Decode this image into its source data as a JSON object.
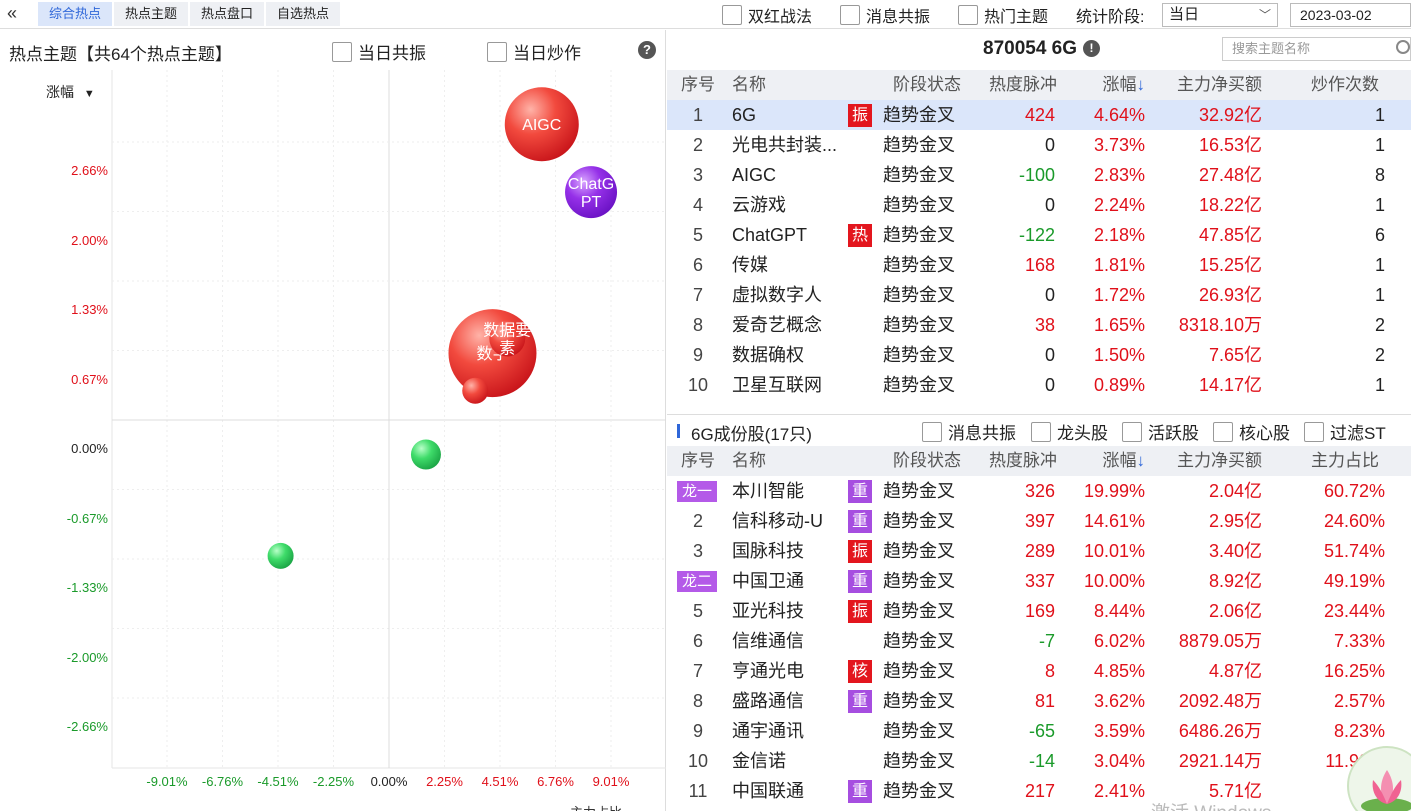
{
  "tabs": [
    "综合热点",
    "热点主题",
    "热点盘口",
    "自选热点"
  ],
  "top_options": [
    "双红战法",
    "消息共振",
    "热门主题"
  ],
  "stat_label": "统计阶段:",
  "stat_value": "当日",
  "date": "2023-03-02",
  "left": {
    "title": "热点主题【共64个热点主题】",
    "opt1": "当日共振",
    "opt2": "当日炒作",
    "help": "?",
    "y_header": "涨幅",
    "x_header": "主力占比"
  },
  "chart_data": {
    "type": "scatter",
    "y_ticks": [
      "2.66%",
      "2.00%",
      "1.33%",
      "0.67%",
      "0.00%",
      "-0.67%",
      "-1.33%",
      "-2.00%",
      "-2.66%"
    ],
    "x_ticks": [
      "-9.01%",
      "-6.76%",
      "-4.51%",
      "-2.25%",
      "0.00%",
      "2.25%",
      "4.51%",
      "6.76%",
      "9.01%"
    ],
    "points": [
      {
        "label": "AIGC",
        "x": 6.2,
        "y": 2.83,
        "size": 37,
        "color": "red"
      },
      {
        "label": "ChatGPT",
        "label_lines": [
          "ChatG",
          "PT"
        ],
        "x": 8.2,
        "y": 2.18,
        "size": 26,
        "color": "purple"
      },
      {
        "label": "数字",
        "x": 4.2,
        "y": 0.64,
        "size": 44,
        "color": "red"
      },
      {
        "label": "数据要素",
        "label_lines": [
          "数据要",
          "素"
        ],
        "x": 4.8,
        "y": 0.78,
        "size": 18,
        "color": "red"
      },
      {
        "label": "",
        "x": 3.5,
        "y": 0.28,
        "size": 13,
        "color": "red"
      },
      {
        "label": "",
        "x": 1.5,
        "y": -0.33,
        "size": 15,
        "color": "green"
      },
      {
        "label": "",
        "x": -4.4,
        "y": -1.3,
        "size": 13,
        "color": "green"
      }
    ]
  },
  "right": {
    "title": "870054 6G",
    "search_placeholder": "搜索主题名称",
    "theme_headers": [
      "序号",
      "名称",
      "阶段状态",
      "热度脉冲",
      "涨幅↓",
      "主力净买额",
      "炒作次数"
    ],
    "themes": [
      {
        "no": "1",
        "name": "6G",
        "tag": "振",
        "stage": "趋势金叉",
        "heat": "424",
        "chg": "4.64%",
        "net": "32.92亿",
        "times": "1"
      },
      {
        "no": "2",
        "name": "光电共封装...",
        "tag": "",
        "stage": "趋势金叉",
        "heat": "0",
        "chg": "3.73%",
        "net": "16.53亿",
        "times": "1"
      },
      {
        "no": "3",
        "name": "AIGC",
        "tag": "",
        "stage": "趋势金叉",
        "heat": "-100",
        "chg": "2.83%",
        "net": "27.48亿",
        "times": "8"
      },
      {
        "no": "4",
        "name": "云游戏",
        "tag": "",
        "stage": "趋势金叉",
        "heat": "0",
        "chg": "2.24%",
        "net": "18.22亿",
        "times": "1"
      },
      {
        "no": "5",
        "name": "ChatGPT",
        "tag": "热",
        "stage": "趋势金叉",
        "heat": "-122",
        "chg": "2.18%",
        "net": "47.85亿",
        "times": "6"
      },
      {
        "no": "6",
        "name": "传媒",
        "tag": "",
        "stage": "趋势金叉",
        "heat": "168",
        "chg": "1.81%",
        "net": "15.25亿",
        "times": "1"
      },
      {
        "no": "7",
        "name": "虚拟数字人",
        "tag": "",
        "stage": "趋势金叉",
        "heat": "0",
        "chg": "1.72%",
        "net": "26.93亿",
        "times": "1"
      },
      {
        "no": "8",
        "name": "爱奇艺概念",
        "tag": "",
        "stage": "趋势金叉",
        "heat": "38",
        "chg": "1.65%",
        "net": "8318.10万",
        "times": "2"
      },
      {
        "no": "9",
        "name": "数据确权",
        "tag": "",
        "stage": "趋势金叉",
        "heat": "0",
        "chg": "1.50%",
        "net": "7.65亿",
        "times": "2"
      },
      {
        "no": "10",
        "name": "卫星互联网",
        "tag": "",
        "stage": "趋势金叉",
        "heat": "0",
        "chg": "0.89%",
        "net": "14.17亿",
        "times": "1"
      }
    ],
    "sub_title": "6G成份股(17只)",
    "sub_filters": [
      "消息共振",
      "龙头股",
      "活跃股",
      "核心股",
      "过滤ST"
    ],
    "stock_headers": [
      "序号",
      "名称",
      "阶段状态",
      "热度脉冲",
      "涨幅↓",
      "主力净买额",
      "主力占比"
    ],
    "stocks": [
      {
        "no": "龙一",
        "name": "本川智能",
        "tag": "重",
        "stage": "趋势金叉",
        "heat": "326",
        "chg": "19.99%",
        "net": "2.04亿",
        "ratio": "60.72%"
      },
      {
        "no": "2",
        "name": "信科移动-U",
        "tag": "重",
        "stage": "趋势金叉",
        "heat": "397",
        "chg": "14.61%",
        "net": "2.95亿",
        "ratio": "24.60%"
      },
      {
        "no": "3",
        "name": "国脉科技",
        "tag": "振",
        "stage": "趋势金叉",
        "heat": "289",
        "chg": "10.01%",
        "net": "3.40亿",
        "ratio": "51.74%"
      },
      {
        "no": "龙二",
        "name": "中国卫通",
        "tag": "重",
        "stage": "趋势金叉",
        "heat": "337",
        "chg": "10.00%",
        "net": "8.92亿",
        "ratio": "49.19%"
      },
      {
        "no": "5",
        "name": "亚光科技",
        "tag": "振",
        "stage": "趋势金叉",
        "heat": "169",
        "chg": "8.44%",
        "net": "2.06亿",
        "ratio": "23.44%"
      },
      {
        "no": "6",
        "name": "信维通信",
        "tag": "",
        "stage": "趋势金叉",
        "heat": "-7",
        "chg": "6.02%",
        "net": "8879.05万",
        "ratio": "7.33%"
      },
      {
        "no": "7",
        "name": "亨通光电",
        "tag": "核",
        "stage": "趋势金叉",
        "heat": "8",
        "chg": "4.85%",
        "net": "4.87亿",
        "ratio": "16.25%"
      },
      {
        "no": "8",
        "name": "盛路通信",
        "tag": "重",
        "stage": "趋势金叉",
        "heat": "81",
        "chg": "3.62%",
        "net": "2092.48万",
        "ratio": "2.57%"
      },
      {
        "no": "9",
        "name": "通宇通讯",
        "tag": "",
        "stage": "趋势金叉",
        "heat": "-65",
        "chg": "3.59%",
        "net": "6486.26万",
        "ratio": "8.23%"
      },
      {
        "no": "10",
        "name": "金信诺",
        "tag": "",
        "stage": "趋势金叉",
        "heat": "-14",
        "chg": "3.04%",
        "net": "2921.14万",
        "ratio": "11.90%"
      },
      {
        "no": "11",
        "name": "中国联通",
        "tag": "重",
        "stage": "趋势金叉",
        "heat": "217",
        "chg": "2.41%",
        "net": "5.71亿",
        "ratio": "8.9"
      }
    ],
    "watermark": "激活 Windows"
  }
}
